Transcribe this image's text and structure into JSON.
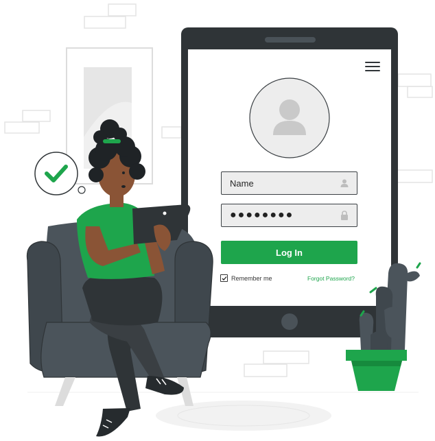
{
  "login_form": {
    "name_value": "Name",
    "password_value": "●●●●●●●●",
    "login_label": "Log In",
    "remember_label": "Remember me",
    "remember_checked": true,
    "forgot_label": "Forgot Password?"
  },
  "colors": {
    "accent": "#1ea54c",
    "phone_frame": "#2f3437",
    "chair": "#4b545b",
    "field_bg": "#ededed"
  },
  "icons": {
    "menu": "hamburger-menu-icon",
    "avatar": "user-avatar-icon",
    "name_field": "user-icon",
    "password_field": "lock-icon",
    "status": "checkmark-icon"
  }
}
